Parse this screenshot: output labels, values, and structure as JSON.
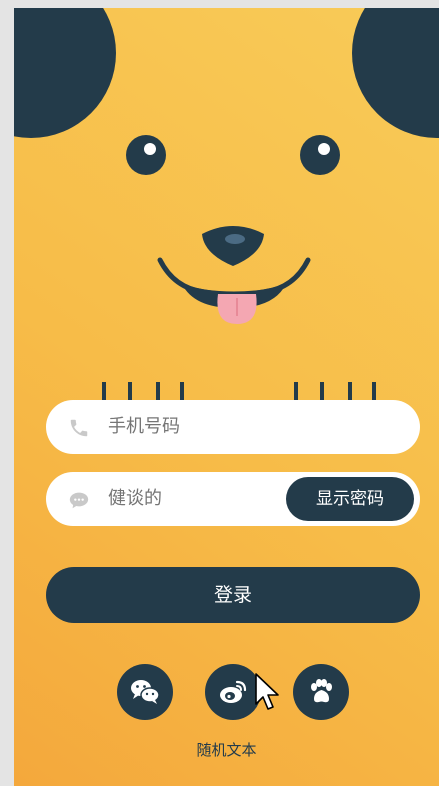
{
  "colors": {
    "dark": "#233b4a",
    "tongue": "#f4a7b2",
    "bg_start": "#f4a83c",
    "bg_end": "#f8cb58"
  },
  "form": {
    "phone_placeholder": "手机号码",
    "phone_icon": "phone-icon",
    "password_placeholder": "健谈的",
    "password_icon": "chat-bubble-icon",
    "show_password_label": "显示密码",
    "login_label": "登录"
  },
  "social": [
    {
      "name": "wechat",
      "icon": "wechat-icon"
    },
    {
      "name": "weibo",
      "icon": "weibo-icon"
    },
    {
      "name": "paw",
      "icon": "paw-icon"
    }
  ],
  "footer": {
    "random_text": "随机文本"
  }
}
